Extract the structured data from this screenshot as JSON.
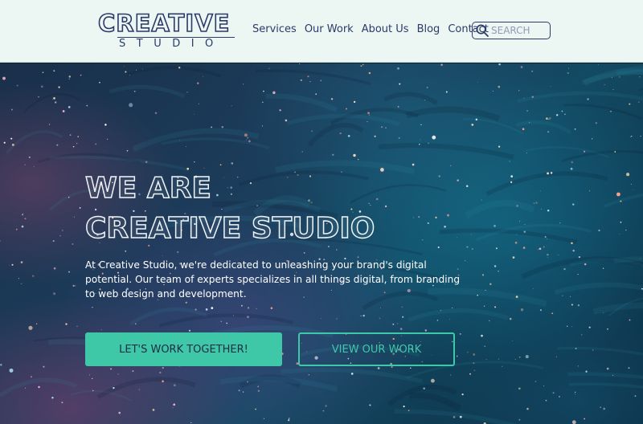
{
  "brand": {
    "logo_main": "CREATIVE",
    "logo_sub": "STUDIO"
  },
  "nav": {
    "items": [
      {
        "label": "Services"
      },
      {
        "label": "Our Work"
      },
      {
        "label": "About Us"
      },
      {
        "label": "Blog"
      },
      {
        "label": "Contact"
      }
    ]
  },
  "search": {
    "placeholder": "SEARCH",
    "icon": "search-icon"
  },
  "hero": {
    "title_line1": "WE ARE",
    "title_line2": "CREATIVE STUDIO",
    "description": "At Creative Studio, we're dedicated to unleashing your brand's digital potential. Our team of experts specializes in all things digital, from branding to web design and development.",
    "primary_button": "LET'S WORK TOGETHER!",
    "secondary_button": "VIEW OUR WORK"
  },
  "colors": {
    "header_bg": "#ecf7f4",
    "navy": "#2c3a68",
    "accent": "#3fc8a8"
  }
}
